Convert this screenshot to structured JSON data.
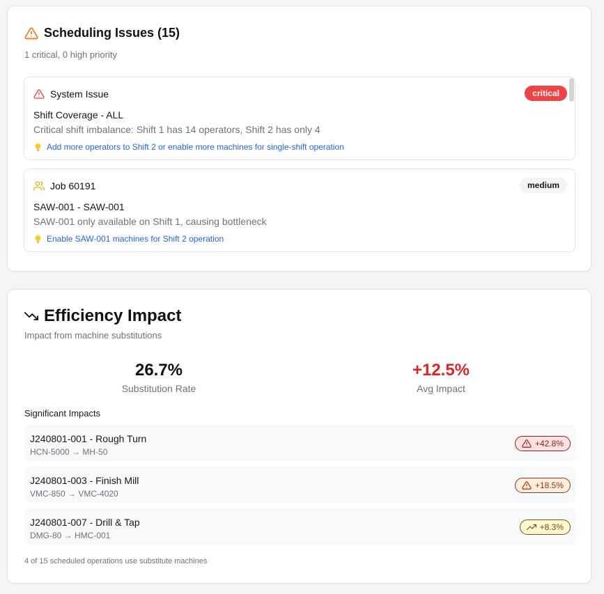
{
  "issues": {
    "title": "Scheduling Issues (15)",
    "subtitle": "1 critical, 0 high priority",
    "items": [
      {
        "type": "System Issue",
        "icon": "alert-triangle-icon",
        "severity": "critical",
        "name": "Shift Coverage - ALL",
        "description": "Critical shift imbalance: Shift 1 has 14 operators, Shift 2 has only 4",
        "suggestion": "Add more operators to Shift 2 or enable more machines for single-shift operation"
      },
      {
        "type": "Job 60191",
        "icon": "users-icon",
        "severity": "medium",
        "name": "SAW-001 - SAW-001",
        "description": "SAW-001 only available on Shift 1, causing bottleneck",
        "suggestion": "Enable SAW-001 machines for Shift 2 operation"
      }
    ]
  },
  "efficiency": {
    "title": "Efficiency Impact",
    "subtitle": "Impact from machine substitutions",
    "substitution_rate": "26.7%",
    "substitution_rate_label": "Substitution Rate",
    "avg_impact": "+12.5%",
    "avg_impact_label": "Avg Impact",
    "significant_label": "Significant Impacts",
    "impacts": [
      {
        "name": "J240801-001 - Rough Turn",
        "machines": "HCN-5000 → MH-50",
        "value": "+42.8%",
        "icon": "alert-triangle-icon",
        "tone": "red"
      },
      {
        "name": "J240801-003 - Finish Mill",
        "machines": "VMC-850 → VMC-4020",
        "value": "+18.5%",
        "icon": "alert-triangle-icon",
        "tone": "orange"
      },
      {
        "name": "J240801-007 - Drill & Tap",
        "machines": "DMG-80 → HMC-001",
        "value": "+8.3%",
        "icon": "trending-up-icon",
        "tone": "yellow"
      }
    ],
    "footer": "4 of 15 scheduled operations use substitute machines"
  },
  "colors": {
    "critical": "#ef4444",
    "warning_icon": "#f97316",
    "users_icon": "#eab308",
    "link": "#2563eb",
    "negative": "#dc2626"
  }
}
